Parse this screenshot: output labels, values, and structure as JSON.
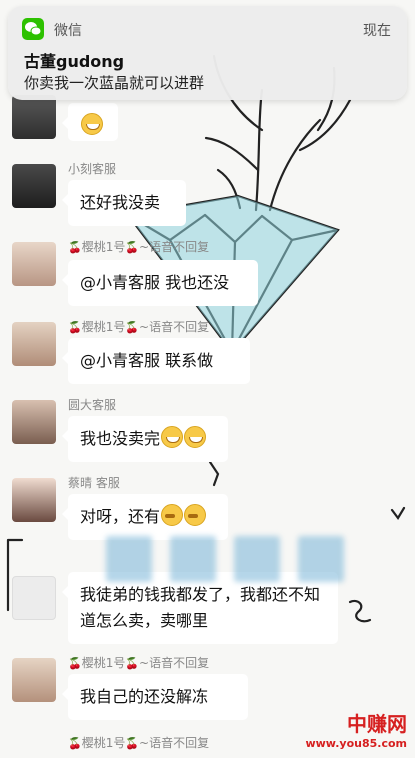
{
  "notification": {
    "app": "微信",
    "time": "现在",
    "title": "古董gudong",
    "body": "你卖我一次蓝晶就可以进群"
  },
  "messages": [
    {
      "sender": "",
      "text": ""
    },
    {
      "sender": "小刻客服",
      "text": "还好我没卖"
    },
    {
      "sender_name": "樱桃1号",
      "sender_tail": "~语音不回复",
      "text": "@小青客服 我也还没"
    },
    {
      "sender_name": "樱桃1号",
      "sender_tail": "~语音不回复",
      "text": "@小青客服 联系做"
    },
    {
      "sender": "圆大客服",
      "text": "我也没卖完"
    },
    {
      "sender": "蔡晴 客服",
      "text": "对呀，还有"
    },
    {
      "sender": "",
      "text": "我徒弟的钱我都发了，我都还不知道怎么卖，卖哪里"
    },
    {
      "sender_name": "樱桃1号",
      "sender_tail": "~语音不回复",
      "text": "我自己的还没解冻"
    },
    {
      "sender_name": "樱桃1号",
      "sender_tail": "~语音不回复",
      "text": ""
    }
  ],
  "watermark": {
    "site_cn": "中赚网",
    "site_url": "www.you85.com"
  },
  "icons": {
    "notification_app": "wechat-icon",
    "cherry": "cherry-icon"
  },
  "colors": {
    "bubble": "#ffffff",
    "background": "#f7f7f5",
    "wechat_green": "#2dc100",
    "diamond": "#8fd3dc",
    "watermark_red": "#d62020"
  }
}
